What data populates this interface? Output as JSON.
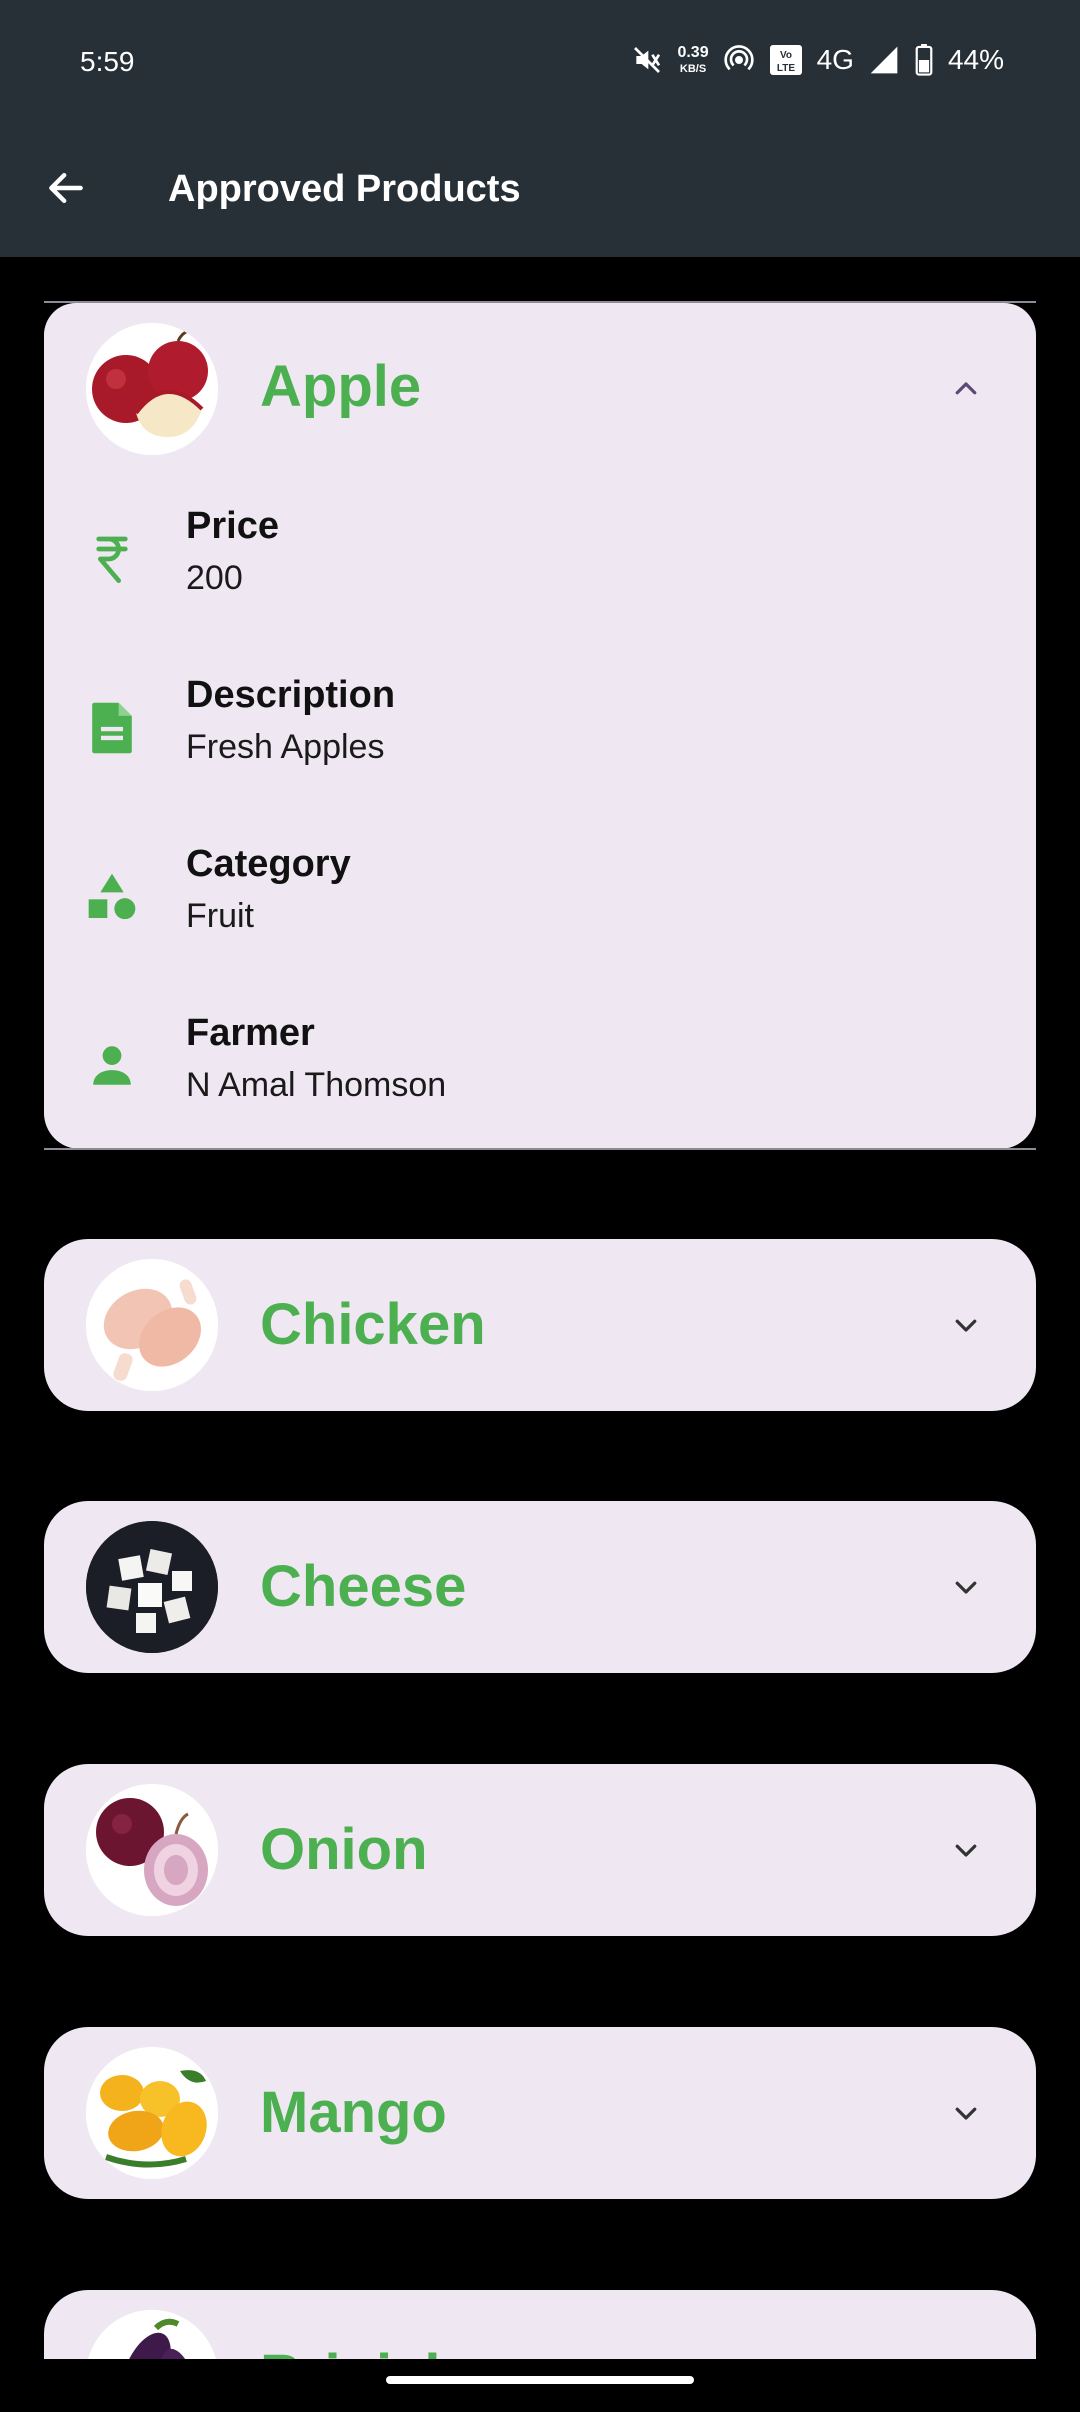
{
  "status_bar": {
    "time": "5:59",
    "net_speed": "0.39",
    "net_unit": "KB/S",
    "network": "4G",
    "battery": "44%",
    "icons": [
      "mute-icon",
      "hotspot-icon",
      "volte-icon",
      "signal-icon",
      "battery-icon"
    ]
  },
  "app_bar": {
    "title": "Approved Products",
    "back_icon": "arrow-back-icon"
  },
  "products": [
    {
      "name": "Apple",
      "expanded": true,
      "details": [
        {
          "icon": "rupee-icon",
          "label": "Price",
          "value": "200"
        },
        {
          "icon": "document-icon",
          "label": "Description",
          "value": "Fresh Apples"
        },
        {
          "icon": "category-icon",
          "label": "Category",
          "value": "Fruit"
        },
        {
          "icon": "person-icon",
          "label": "Farmer",
          "value": "N Amal Thomson"
        }
      ]
    },
    {
      "name": "Chicken",
      "expanded": false
    },
    {
      "name": "Cheese",
      "expanded": false
    },
    {
      "name": "Onion",
      "expanded": false
    },
    {
      "name": "Mango",
      "expanded": false
    },
    {
      "name": "Brinjal",
      "expanded": false
    }
  ],
  "colors": {
    "accent": "#4caf50",
    "card_bg": "#efe8f3",
    "app_bar_bg": "#263036",
    "chevron": "#5a4a78"
  }
}
